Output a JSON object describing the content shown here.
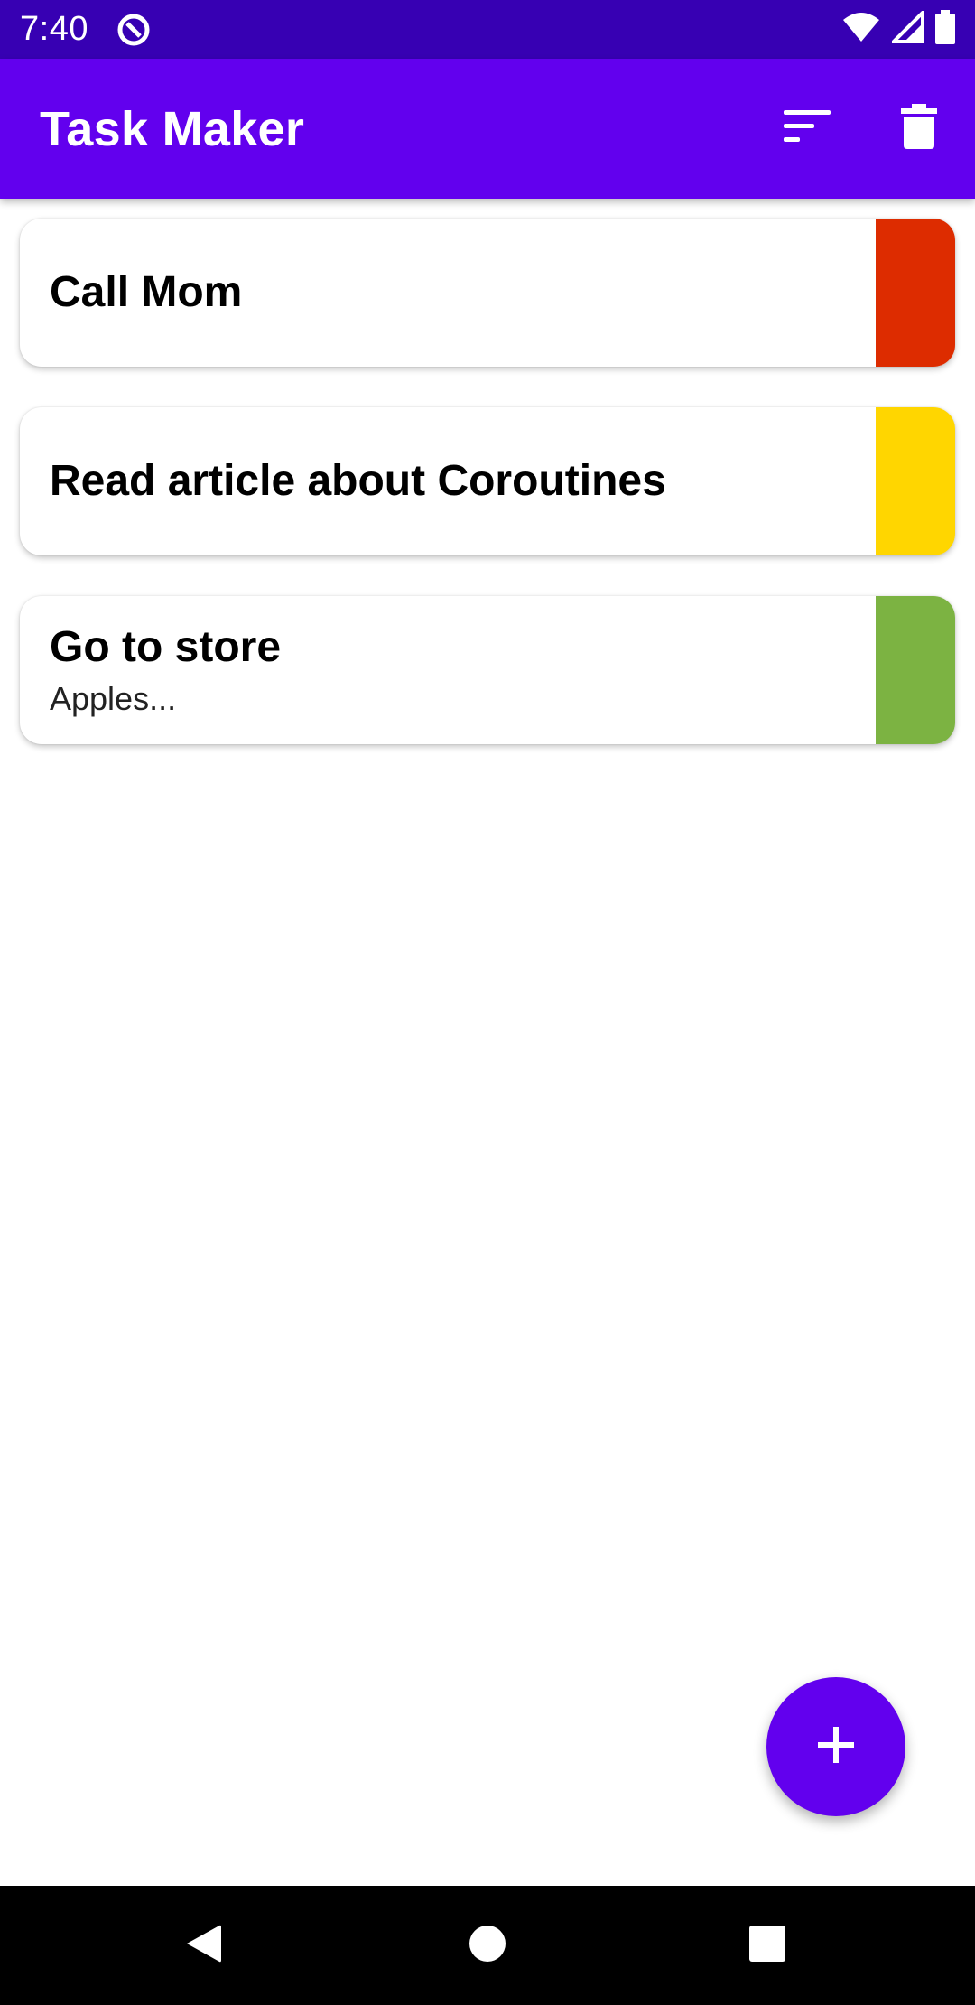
{
  "status_bar": {
    "time": "7:40",
    "icons": [
      "app-notification-icon",
      "wifi-icon",
      "cellular-signal-icon",
      "battery-icon"
    ]
  },
  "app_bar": {
    "title": "Task Maker",
    "actions": [
      "sort-icon",
      "delete-all-icon"
    ]
  },
  "tasks": [
    {
      "title": "Call Mom",
      "description": "",
      "priority_color": "#dd2c00"
    },
    {
      "title": "Read article about Coroutines",
      "description": "",
      "priority_color": "#ffd600"
    },
    {
      "title": "Go to store",
      "description": "Apples...",
      "priority_color": "#7cb342"
    }
  ],
  "fab": {
    "icon": "add-icon"
  },
  "nav_bar": {
    "icons": [
      "back-icon",
      "home-icon",
      "recents-icon"
    ]
  },
  "colors": {
    "status_bar": "#3700b3",
    "primary": "#6200ee",
    "priority_high": "#dd2c00",
    "priority_medium": "#ffd600",
    "priority_low": "#7cb342"
  }
}
